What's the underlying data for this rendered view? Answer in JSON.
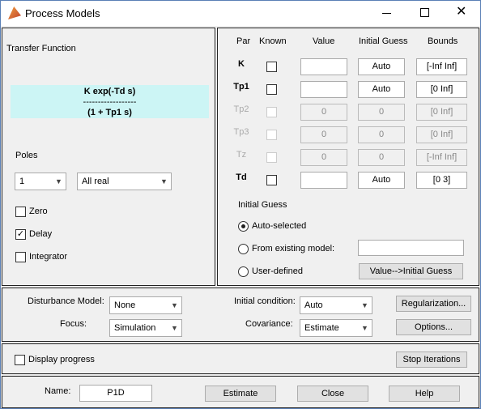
{
  "window": {
    "title": "Process Models",
    "app_icon": "matlab-icon",
    "controls": [
      "minimize-icon",
      "maximize-icon",
      "close-icon"
    ]
  },
  "transfer": {
    "heading": "Transfer Function",
    "numerator": "K exp(-Td s)",
    "divider": "------------------",
    "denominator": "(1 + Tp1 s)",
    "bg": "#ccf5f5"
  },
  "poles": {
    "label": "Poles",
    "count": "1",
    "type": "All real"
  },
  "options": {
    "zero": {
      "label": "Zero",
      "checked": false
    },
    "delay": {
      "label": "Delay",
      "checked": true
    },
    "integrator": {
      "label": "Integrator",
      "checked": false
    }
  },
  "params": {
    "headers": [
      "Par",
      "Known",
      "Value",
      "Initial Guess",
      "Bounds"
    ],
    "rows": [
      {
        "par": "K",
        "value": "",
        "guess": "Auto",
        "bounds": "[-Inf Inf]",
        "enabled": true
      },
      {
        "par": "Tp1",
        "value": "",
        "guess": "Auto",
        "bounds": "[0 Inf]",
        "enabled": true
      },
      {
        "par": "Tp2",
        "value": "0",
        "guess": "0",
        "bounds": "[0 Inf]",
        "enabled": false
      },
      {
        "par": "Tp3",
        "value": "0",
        "guess": "0",
        "bounds": "[0 Inf]",
        "enabled": false
      },
      {
        "par": "Tz",
        "value": "0",
        "guess": "0",
        "bounds": "[-Inf Inf]",
        "enabled": false
      },
      {
        "par": "Td",
        "value": "",
        "guess": "Auto",
        "bounds": "[0 3]",
        "enabled": true
      }
    ]
  },
  "initial_guess": {
    "heading": "Initial Guess",
    "auto": "Auto-selected",
    "existing": "From existing model:",
    "existing_value": "",
    "user": "User-defined",
    "selected": "auto",
    "button": "Value-->Initial Guess"
  },
  "settings": {
    "disturbance_label": "Disturbance Model:",
    "disturbance": "None",
    "focus_label": "Focus:",
    "focus": "Simulation",
    "initcond_label": "Initial condition:",
    "initcond": "Auto",
    "covariance_label": "Covariance:",
    "covariance": "Estimate",
    "regularization": "Regularization...",
    "options": "Options..."
  },
  "progress": {
    "label": "Display progress",
    "checked": false,
    "stop": "Stop Iterations"
  },
  "footer": {
    "name_label": "Name:",
    "name": "P1D",
    "estimate": "Estimate",
    "close": "Close",
    "help": "Help"
  }
}
